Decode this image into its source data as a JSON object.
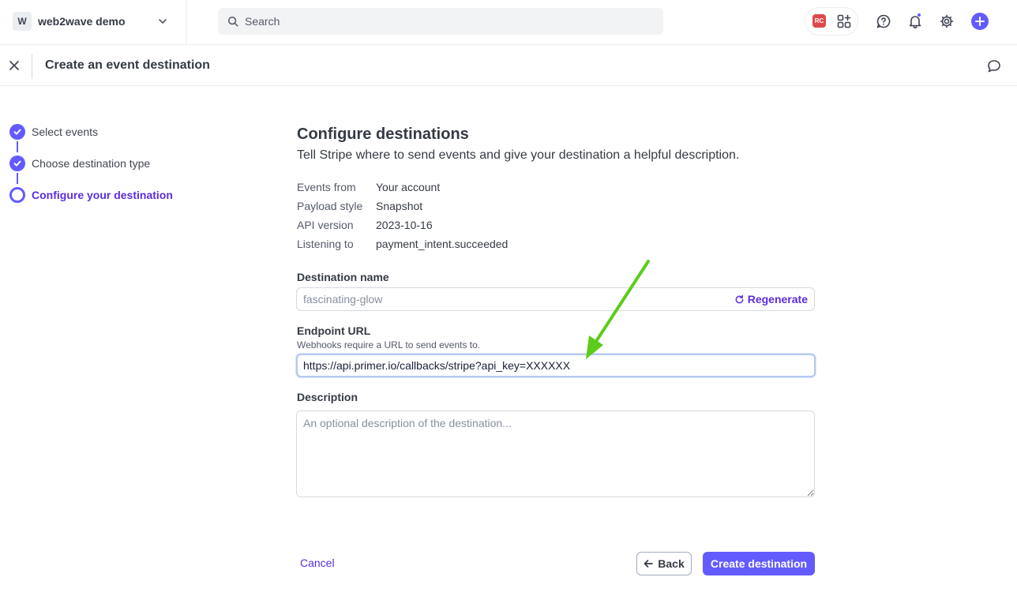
{
  "topbar": {
    "account_initial": "W",
    "account_name": "web2wave demo",
    "search_placeholder": "Search",
    "app_badge": "RC"
  },
  "header": {
    "title": "Create an event destination"
  },
  "steps": [
    {
      "label": "Select events",
      "state": "done"
    },
    {
      "label": "Choose destination type",
      "state": "done"
    },
    {
      "label": "Configure your destination",
      "state": "active"
    }
  ],
  "main": {
    "title": "Configure destinations",
    "subtitle": "Tell Stripe where to send events and give your destination a helpful description.",
    "meta": [
      {
        "key": "Events from",
        "value": "Your account"
      },
      {
        "key": "Payload style",
        "value": "Snapshot"
      },
      {
        "key": "API version",
        "value": "2023-10-16"
      },
      {
        "key": "Listening to",
        "value": "payment_intent.succeeded"
      }
    ],
    "destination_name": {
      "label": "Destination name",
      "placeholder": "fascinating-glow",
      "regenerate_label": "Regenerate"
    },
    "endpoint_url": {
      "label": "Endpoint URL",
      "hint": "Webhooks require a URL to send events to.",
      "value": "https://api.primer.io/callbacks/stripe?api_key=XXXXXX"
    },
    "description": {
      "label": "Description",
      "placeholder": "An optional description of the destination..."
    }
  },
  "footer": {
    "cancel_label": "Cancel",
    "back_label": "Back",
    "create_label": "Create destination"
  },
  "colors": {
    "accent": "#635bff",
    "link": "#5b2de0",
    "annotation_arrow": "#5ccc1a"
  }
}
